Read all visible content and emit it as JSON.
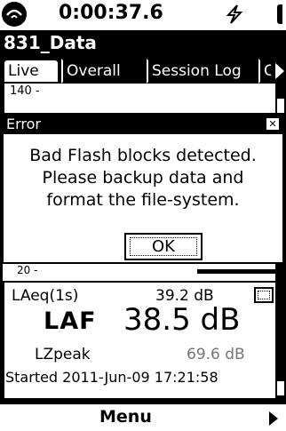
{
  "status": {
    "elapsed_time": "0:00:37.6"
  },
  "window": {
    "title": "831_Data"
  },
  "tabs": [
    {
      "label": "Live",
      "active": true
    },
    {
      "label": "Overall",
      "active": false
    },
    {
      "label": "Session Log",
      "active": false
    },
    {
      "label": "C",
      "active": false
    }
  ],
  "graph": {
    "top_tick": "140 -",
    "bottom_tick": "20 -"
  },
  "dialog": {
    "title": "Error",
    "close_glyph": "✕",
    "message_lines": [
      "Bad Flash blocks detected.",
      "Please backup data and",
      "format the file-system."
    ],
    "ok_label": "OK"
  },
  "readings": {
    "laeq_label": "LAeq(1s)",
    "laeq_value": "39.2 dB",
    "laf_label": "LAF",
    "laf_value": "38.5 dB",
    "lzpeak_label": "LZpeak",
    "lzpeak_value": "69.6 dB",
    "started": "Started 2011-Jun-09 17:21:58"
  },
  "bottom": {
    "menu_label": "Menu"
  },
  "colors": {
    "background": "#000000",
    "panel": "#ffffff",
    "dim_text": "#777777"
  },
  "icons": {
    "logo": "power-logo-icon",
    "battery": "lightning-bolt-icon",
    "view_toggle": "display-mode-icon"
  }
}
